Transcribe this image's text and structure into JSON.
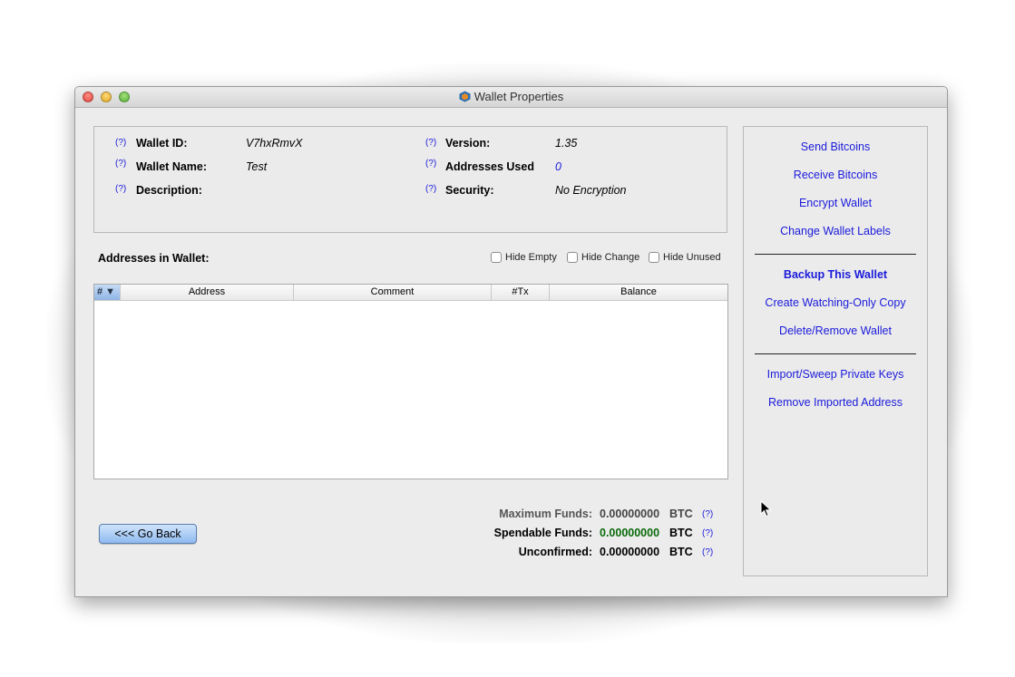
{
  "window": {
    "title": "Wallet Properties"
  },
  "help_mark": "(?)",
  "info": {
    "wallet_id": {
      "label": "Wallet ID:",
      "value": "V7hxRmvX"
    },
    "wallet_name": {
      "label": "Wallet Name:",
      "value": "Test"
    },
    "description": {
      "label": "Description:",
      "value": ""
    },
    "version": {
      "label": "Version:",
      "value": "1.35"
    },
    "addresses_used": {
      "label": "Addresses Used",
      "value": "0"
    },
    "security": {
      "label": "Security:",
      "value": "No Encryption"
    }
  },
  "addresses": {
    "title": "Addresses in Wallet:",
    "filters": [
      "Hide Empty",
      "Hide Change",
      "Hide Unused"
    ],
    "columns": {
      "num": "# ▼",
      "address": "Address",
      "comment": "Comment",
      "tx": "#Tx",
      "balance": "Balance"
    },
    "rows": []
  },
  "funds": {
    "maximum": {
      "label": "Maximum Funds:",
      "amount": "0.00000000",
      "unit": "BTC"
    },
    "spendable": {
      "label": "Spendable Funds:",
      "amount": "0.00000000",
      "unit": "BTC"
    },
    "unconfirmed": {
      "label": "Unconfirmed:",
      "amount": "0.00000000",
      "unit": "BTC"
    }
  },
  "go_back_label": "<<< Go Back",
  "sidebar": {
    "send": "Send Bitcoins",
    "receive": "Receive Bitcoins",
    "encrypt": "Encrypt Wallet",
    "labels": "Change Wallet Labels",
    "backup": "Backup This Wallet",
    "watching": "Create Watching-Only Copy",
    "delete": "Delete/Remove Wallet",
    "import": "Import/Sweep Private Keys",
    "remove_imported": "Remove Imported Address"
  },
  "colors": {
    "link": "#1a1adb",
    "spendable": "#0a6a0a",
    "max_label": "#555555"
  }
}
